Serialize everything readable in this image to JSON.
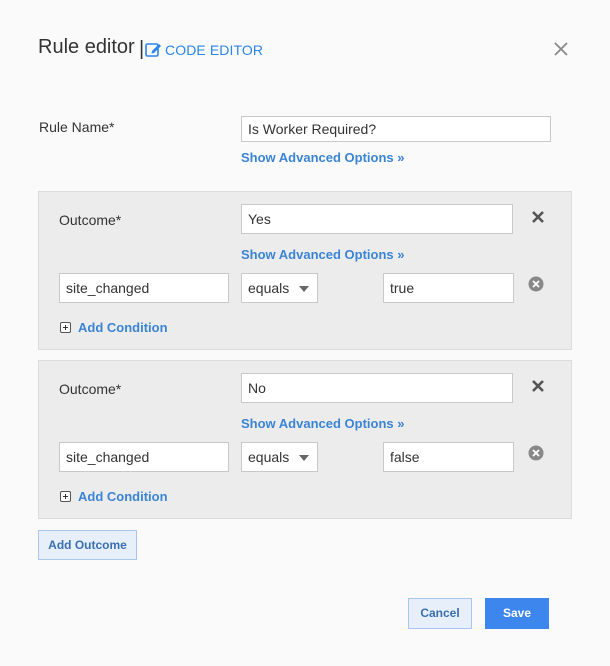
{
  "header": {
    "title": "Rule editor",
    "separator": "|",
    "code_editor_label": "CODE EDITOR"
  },
  "rule": {
    "name_label": "Rule Name*",
    "name_value": "Is Worker Required?",
    "advanced_link": "Show Advanced Options »"
  },
  "outcomes": [
    {
      "label": "Outcome*",
      "value": "Yes",
      "advanced_link": "Show Advanced Options »",
      "condition": {
        "field": "site_changed",
        "operator": "equals",
        "value": "true"
      },
      "add_condition_label": "Add Condition"
    },
    {
      "label": "Outcome*",
      "value": "No",
      "advanced_link": "Show Advanced Options »",
      "condition": {
        "field": "site_changed",
        "operator": "equals",
        "value": "false"
      },
      "add_condition_label": "Add Condition"
    }
  ],
  "footer": {
    "add_outcome_label": "Add Outcome",
    "cancel_label": "Cancel",
    "save_label": "Save"
  },
  "colors": {
    "accent": "#3a84d6",
    "primary_button": "#3d86ee",
    "panel_bg": "#ececec"
  },
  "icons": {
    "code_editor": "edit-icon",
    "close": "close-icon",
    "remove_outcome": "x-icon",
    "remove_condition": "circle-x-icon",
    "add_condition": "plus-box-icon",
    "select": "chevron-down-icon"
  }
}
